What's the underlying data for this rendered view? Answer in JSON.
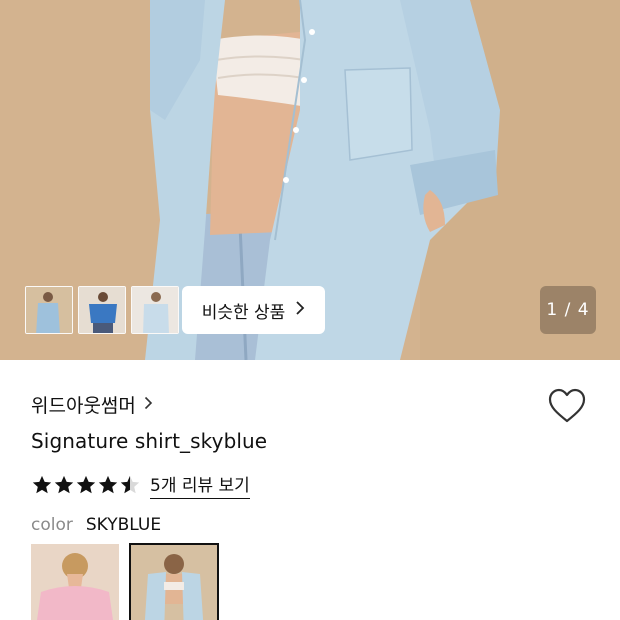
{
  "gallery": {
    "similar_button_label": "비슷한 상품",
    "counter": "1 / 4",
    "thumbnails": [
      "thumbnail-1",
      "thumbnail-2",
      "thumbnail-3"
    ]
  },
  "product": {
    "brand": "위드아웃썸머",
    "title": "Signature shirt_skyblue",
    "rating_stars": 4.5,
    "review_link": "5개 리뷰 보기"
  },
  "options": {
    "color_label": "color",
    "color_value": "SKYBLUE",
    "swatches": [
      "pink",
      "skyblue"
    ],
    "selected_swatch": "skyblue"
  },
  "icons": {
    "heart": "heart-outline-icon",
    "chevron": "chevron-right-icon",
    "star": "star-icon"
  },
  "colors": {
    "text": "#111111",
    "muted": "#8a8a8a",
    "shirt_blue": "#b9d3e3",
    "pink": "#f2b8c8"
  }
}
